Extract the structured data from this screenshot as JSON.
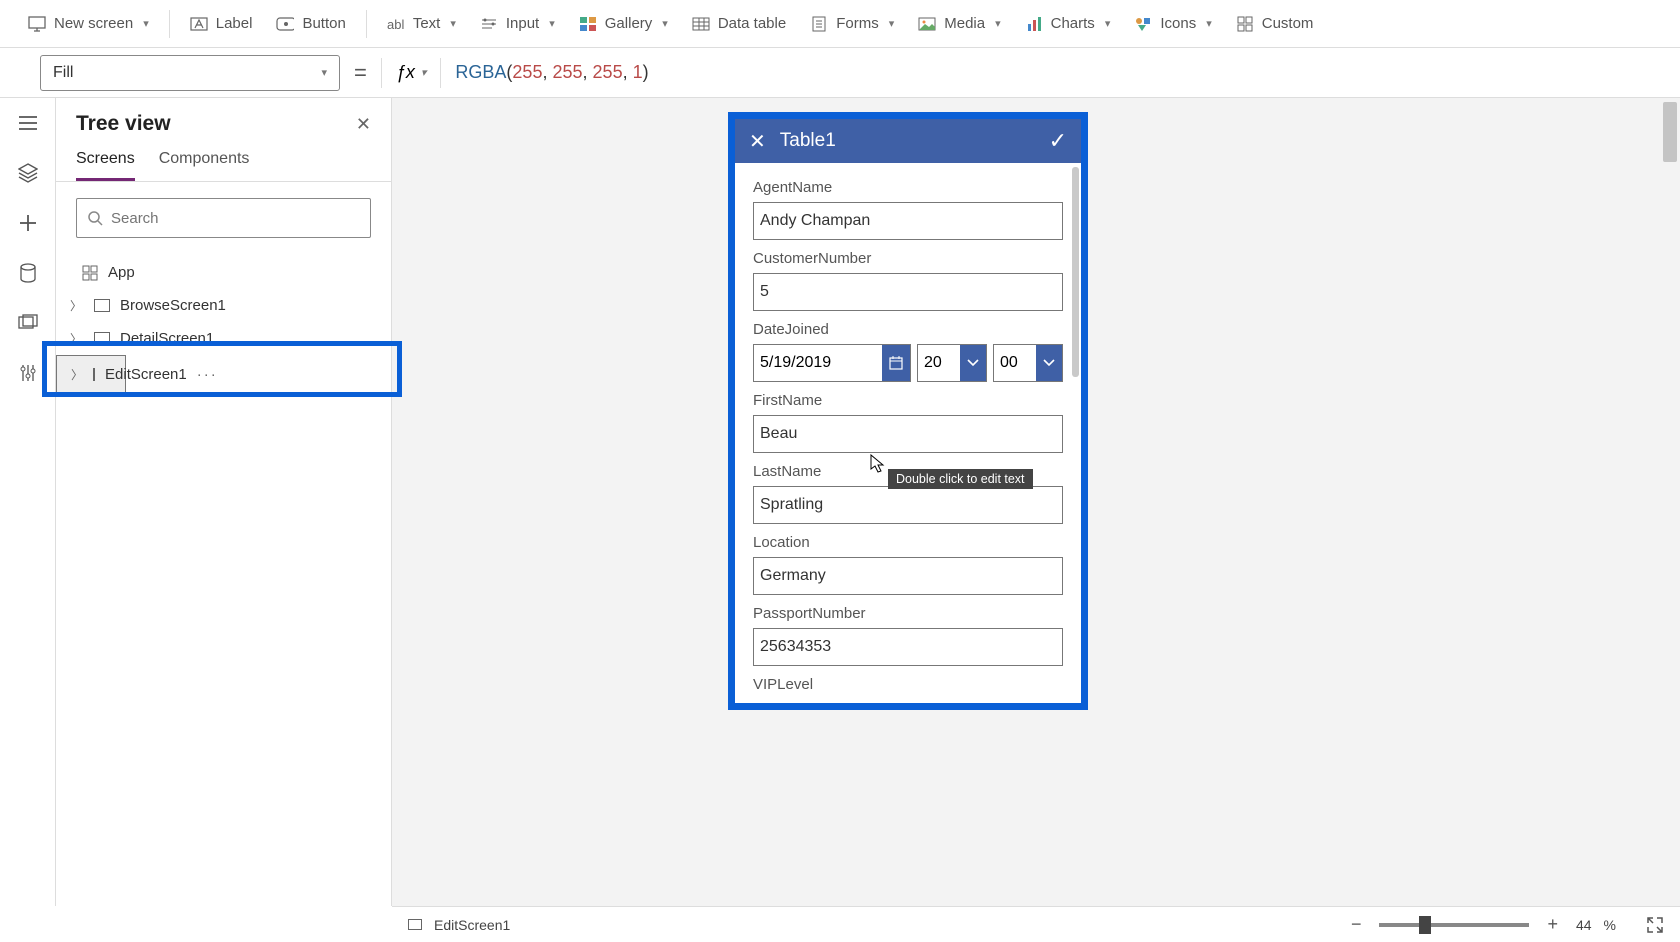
{
  "ribbon": {
    "new_screen": "New screen",
    "label": "Label",
    "button": "Button",
    "text": "Text",
    "input": "Input",
    "gallery": "Gallery",
    "data_table": "Data table",
    "forms": "Forms",
    "media": "Media",
    "charts": "Charts",
    "icons": "Icons",
    "custom": "Custom"
  },
  "formula_bar": {
    "property": "Fill",
    "fn": "RGBA",
    "args": [
      "255",
      "255",
      "255",
      "1"
    ]
  },
  "panel": {
    "title": "Tree view",
    "tab_screens": "Screens",
    "tab_components": "Components",
    "search_placeholder": "Search",
    "app": "App",
    "items": [
      "BrowseScreen1",
      "DetailScreen1",
      "EditScreen1"
    ]
  },
  "canvas_form": {
    "title": "Table1",
    "fields": {
      "agent_lbl": "AgentName",
      "agent_val": "Andy Champan",
      "cust_lbl": "CustomerNumber",
      "cust_val": "5",
      "date_lbl": "DateJoined",
      "date_val": "5/19/2019",
      "hour_val": "20",
      "min_val": "00",
      "first_lbl": "FirstName",
      "first_val": "Beau",
      "last_lbl": "LastName",
      "last_val": "Spratling",
      "loc_lbl": "Location",
      "loc_val": "Germany",
      "pass_lbl": "PassportNumber",
      "pass_val": "25634353",
      "vip_lbl": "VIPLevel"
    }
  },
  "tooltip": "Double click to edit text",
  "footer": {
    "screen": "EditScreen1",
    "zoom": "44",
    "pct": "%"
  }
}
